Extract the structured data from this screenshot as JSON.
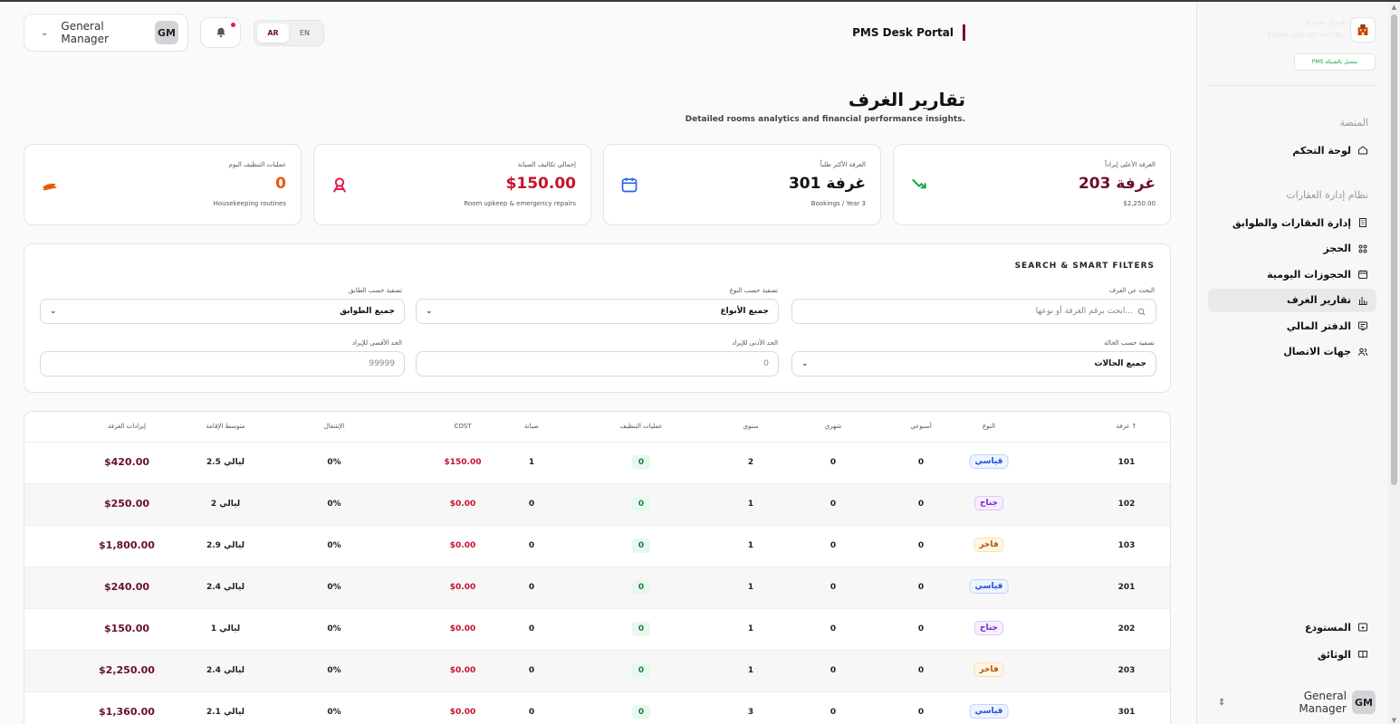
{
  "header": {
    "user_name": "General Manager",
    "user_initials": "GM",
    "lang_ar": "AR",
    "lang_en": "EN",
    "portal_title": "PMS Desk Portal"
  },
  "page": {
    "title": "تقارير الغرف",
    "subtitle": "Detailed rooms analytics and financial performance insights."
  },
  "stats": [
    {
      "label": "الغرفة الأعلى إيراداً",
      "value": "غرفة 203",
      "sub": "$2,250.00",
      "icon": "trend-down-icon",
      "color": "#16a34a"
    },
    {
      "label": "الغرفة الأكثر طلباً",
      "value": "غرفة 301",
      "sub": "Bookings / Year 3",
      "icon": "calendar-icon",
      "color": "#2563eb"
    },
    {
      "label": "إجمالي تكاليف الصيانة",
      "value": "$150.00",
      "sub": "Room upkeep & emergency repairs",
      "icon": "wrench-icon",
      "color": "#e11d48"
    },
    {
      "label": "عمليات التنظيف اليوم",
      "value": "0",
      "sub": "Housekeeping routines",
      "icon": "broom-icon",
      "color": "#ea580c"
    }
  ],
  "filters": {
    "title": "SEARCH & SMART FILTERS",
    "search_label": "البحث عن الغرف",
    "search_placeholder": "ابحث برقم الغرفة أو نوعها...",
    "type_label": "تصفية حسب النوع",
    "type_value": "جميع الأنواع",
    "floor_label": "تصفية حسب الطابق",
    "floor_value": "جميع الطوابق",
    "status_label": "تصفية حسب الحالة",
    "status_value": "جميع الحالات",
    "min_label": "الحد الأدنى للإيراد",
    "min_value": "0",
    "max_label": "الحد الأقصى للإيراد",
    "max_value": "99999"
  },
  "table": {
    "headers": {
      "room": "غرفة ↑",
      "type": "النوع",
      "weekly": "أسبوعي",
      "monthly": "شهري",
      "yearly": "سنوي",
      "cleaning": "عمليات التنظيف",
      "maintenance": "صيانة",
      "cost": "COST",
      "occupancy": "الإشغال",
      "avg_stay": "متوسط الإقامة",
      "revenue": "إيرادات الغرفة"
    },
    "rows": [
      {
        "room": "101",
        "type": "قياسي",
        "type_color": "blue",
        "weekly": "0",
        "monthly": "0",
        "yearly": "2",
        "cleaning": "0",
        "maintenance": "1",
        "cost": "$150.00",
        "occupancy": "0%",
        "avg_stay": "2.5 ليالي",
        "revenue": "$420.00"
      },
      {
        "room": "102",
        "type": "جناح",
        "type_color": "purple",
        "weekly": "0",
        "monthly": "0",
        "yearly": "1",
        "cleaning": "0",
        "maintenance": "0",
        "cost": "$0.00",
        "occupancy": "0%",
        "avg_stay": "2 ليالي",
        "revenue": "$250.00"
      },
      {
        "room": "103",
        "type": "فاخر",
        "type_color": "amber",
        "weekly": "0",
        "monthly": "0",
        "yearly": "1",
        "cleaning": "0",
        "maintenance": "0",
        "cost": "$0.00",
        "occupancy": "0%",
        "avg_stay": "2.9 ليالي",
        "revenue": "$1,800.00"
      },
      {
        "room": "201",
        "type": "قياسي",
        "type_color": "blue",
        "weekly": "0",
        "monthly": "0",
        "yearly": "1",
        "cleaning": "0",
        "maintenance": "0",
        "cost": "$0.00",
        "occupancy": "0%",
        "avg_stay": "2.4 ليالي",
        "revenue": "$240.00"
      },
      {
        "room": "202",
        "type": "جناح",
        "type_color": "purple",
        "weekly": "0",
        "monthly": "0",
        "yearly": "1",
        "cleaning": "0",
        "maintenance": "0",
        "cost": "$0.00",
        "occupancy": "0%",
        "avg_stay": "1 ليالي",
        "revenue": "$150.00"
      },
      {
        "room": "203",
        "type": "فاخر",
        "type_color": "amber",
        "weekly": "0",
        "monthly": "0",
        "yearly": "1",
        "cleaning": "0",
        "maintenance": "0",
        "cost": "$0.00",
        "occupancy": "0%",
        "avg_stay": "2.4 ليالي",
        "revenue": "$2,250.00"
      },
      {
        "room": "301",
        "type": "قياسي",
        "type_color": "blue",
        "weekly": "0",
        "monthly": "0",
        "yearly": "3",
        "cleaning": "0",
        "maintenance": "0",
        "cost": "$0.00",
        "occupancy": "0%",
        "avg_stay": "2.1 ليالي",
        "revenue": "$1,360.00"
      }
    ]
  },
  "sidebar": {
    "hotel_name": "فندق سدرة",
    "hotel_sub": "SIDRA LUXURY HOTEL",
    "connection": "PMS متصل بالشبكة",
    "section_platform": "المنصة",
    "dashboard": "لوحة التحكم",
    "section_property": "نظام إدارة العقارات",
    "items": [
      {
        "label": "إدارة العقارات والطوابق",
        "icon": "building-icon"
      },
      {
        "label": "الحجز",
        "icon": "grid-icon"
      },
      {
        "label": "الحجوزات اليومية",
        "icon": "calendar-icon"
      },
      {
        "label": "تقارير الغرف",
        "icon": "bar-chart-icon",
        "active": true
      },
      {
        "label": "الدفتر المالي",
        "icon": "ledger-icon"
      },
      {
        "label": "جهات الاتصال",
        "icon": "users-icon"
      }
    ],
    "warehouse": "المستودع",
    "documents": "الوثائق",
    "user_name": "General Manager",
    "user_initials": "GM"
  }
}
